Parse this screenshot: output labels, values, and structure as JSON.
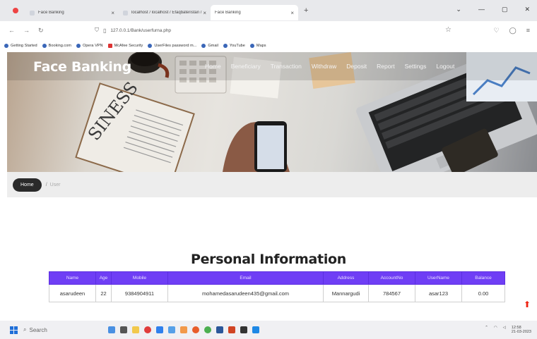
{
  "browser": {
    "tabs": [
      {
        "title": "Face Banking",
        "active": false
      },
      {
        "title": "localhost / localhost / Efaqbateristan / bank",
        "active": false
      },
      {
        "title": "Face Banking",
        "active": true
      }
    ],
    "url": "127.0.0.1/Bank/userfurna.php",
    "bookmarks": [
      "Getting Started",
      "Booking.com",
      "Opera VPN",
      "McAfee Security",
      "UserFiles password m...",
      "Gmail",
      "YouTube",
      "Maps"
    ]
  },
  "site": {
    "brand": "Face Banking",
    "nav": [
      "Home",
      "Beneficiary",
      "Transaction",
      "Withdraw",
      "Deposit",
      "Report",
      "Settings",
      "Logout"
    ]
  },
  "breadcrumb": {
    "home": "Home",
    "separator": "/",
    "current": "User"
  },
  "section_title": "Personal Information",
  "table": {
    "headers": [
      "Name",
      "Age",
      "Mobile",
      "Email",
      "Address",
      "AccountNo",
      "UserName",
      "Balance"
    ],
    "rows": [
      [
        "asarudeen",
        "22",
        "9384904911",
        "mohamedasarudeen435@gmail.com",
        "Mannargudi",
        "784567",
        "asar123",
        "0.00"
      ]
    ]
  },
  "taskbar": {
    "search_placeholder": "Search",
    "clock_time": "12:58",
    "clock_date": "21-03-2023"
  },
  "colors": {
    "table_header": "#6f3ef5",
    "home_pill": "#2a2a2a",
    "scroll_arrow": "#e22211"
  }
}
